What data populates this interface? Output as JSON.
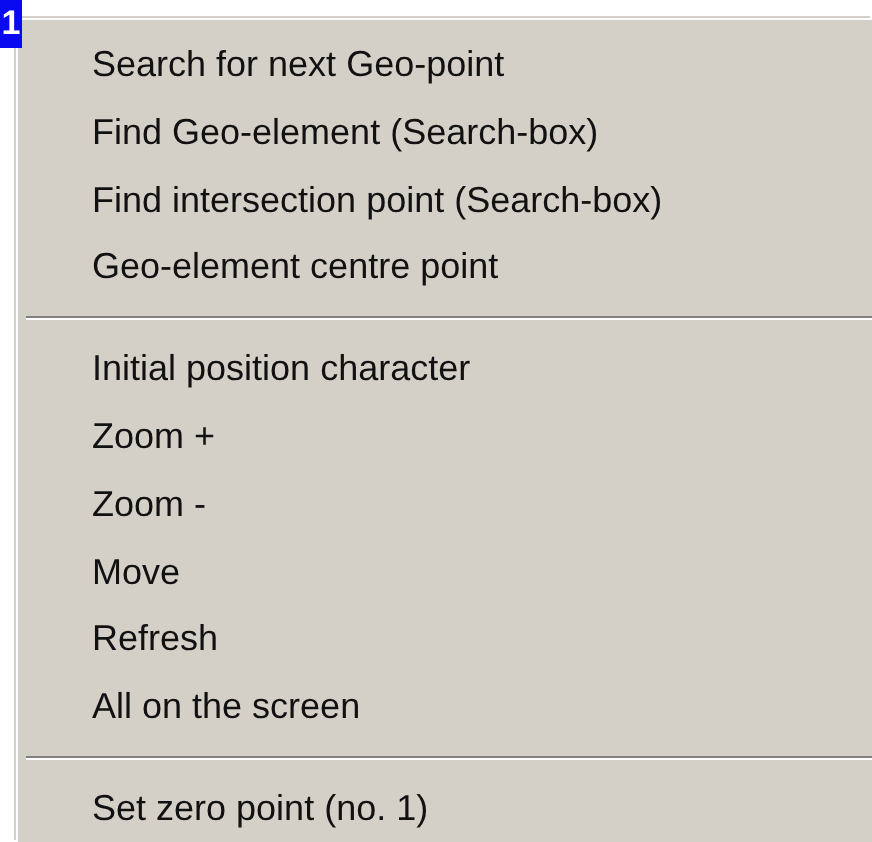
{
  "badge": "1",
  "menu": {
    "groups": [
      {
        "items": [
          "Search for next Geo-point",
          "Find Geo-element (Search-box)",
          "Find intersection point (Search-box)",
          "Geo-element centre point"
        ]
      },
      {
        "items": [
          "Initial position character",
          "Zoom +",
          "Zoom -",
          "Move",
          "Refresh",
          "All on the screen"
        ]
      },
      {
        "items": [
          "Set zero point (no. 1)"
        ]
      }
    ]
  }
}
